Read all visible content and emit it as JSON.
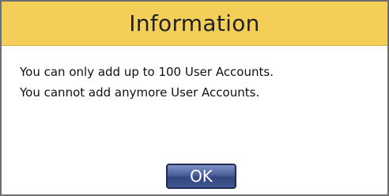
{
  "dialog": {
    "title": "Information",
    "message_lines": [
      "You can only add up to 100 User Accounts.",
      "You cannot add anymore User Accounts."
    ],
    "ok_label": "OK"
  },
  "colors": {
    "titlebar": "#f3cf5a",
    "button": "#3f5591",
    "border": "#6f6f6f"
  }
}
